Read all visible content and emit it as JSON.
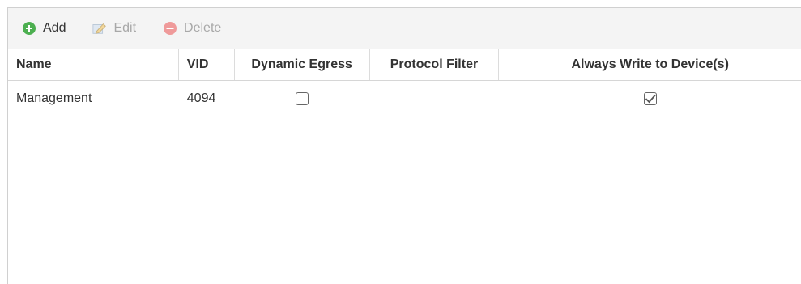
{
  "toolbar": {
    "buttons": [
      {
        "label": "Add",
        "icon": "plus-circle-icon",
        "color": "#4caf50",
        "enabled": true
      },
      {
        "label": "Edit",
        "icon": "pencil-icon",
        "color": "#a8a8a8",
        "enabled": false
      },
      {
        "label": "Delete",
        "icon": "minus-circle-icon",
        "color": "#ef9a9a",
        "enabled": false
      }
    ]
  },
  "grid": {
    "columns": [
      "Name",
      "VID",
      "Dynamic Egress",
      "Protocol Filter",
      "Always Write to Device(s)"
    ],
    "rows": [
      {
        "name": "Management",
        "vid": "4094",
        "dynamic_egress": false,
        "protocol_filter": "",
        "always_write": true
      }
    ]
  }
}
